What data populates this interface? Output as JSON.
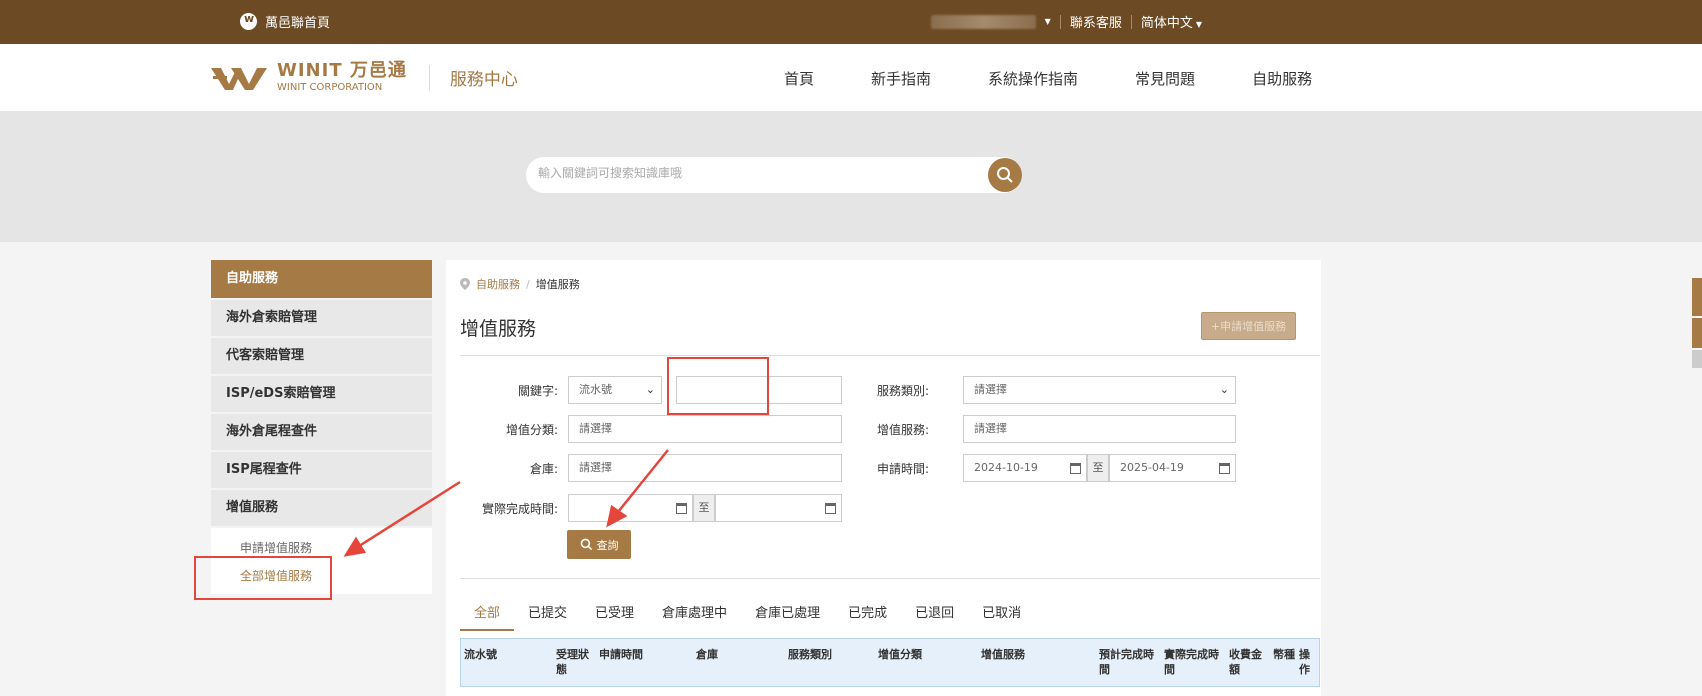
{
  "topbar": {
    "home_label": "萬邑聯首頁",
    "customer_service": "聯系客服",
    "language": "简体中文"
  },
  "header": {
    "brand_mark": "WINIT",
    "brand_cn": "万邑通",
    "brand_en": "WINIT CORPORATION",
    "center_title": "服務中心",
    "nav": [
      "首頁",
      "新手指南",
      "系統操作指南",
      "常見問題",
      "自助服務"
    ]
  },
  "search": {
    "placeholder": "輸入關鍵詞可搜索知識庫哦"
  },
  "sidebar": {
    "header": "自助服務",
    "items": [
      "海外倉索賠管理",
      "代客索賠管理",
      "ISP/eDS索賠管理",
      "海外倉尾程查件",
      "ISP尾程查件",
      "增值服務"
    ],
    "sub_items": [
      "申請增值服務",
      "全部增值服務"
    ]
  },
  "main": {
    "breadcrumb": [
      "自助服務",
      "增值服務"
    ],
    "title": "增值服務",
    "apply_button": "+申請增值服務",
    "form": {
      "keyword_label": "關鍵字:",
      "keyword_type": "流水號",
      "keyword_value": "",
      "service_type_label": "服務類別:",
      "service_type_value": "請選擇",
      "category_label": "增值分類:",
      "category_value": "請選擇",
      "vas_label": "增值服務:",
      "vas_value": "請選擇",
      "warehouse_label": "倉庫:",
      "warehouse_value": "請選擇",
      "apply_time_label": "申請時間:",
      "apply_from": "2024-10-19",
      "apply_to": "2025-04-19",
      "to_sep": "至",
      "actual_time_label": "實際完成時間:",
      "actual_from": "",
      "actual_to": "",
      "query_button": "查詢"
    },
    "tabs": [
      "全部",
      "已提交",
      "已受理",
      "倉庫處理中",
      "倉庫已處理",
      "已完成",
      "已退回",
      "已取消"
    ],
    "columns": [
      "流水號",
      "受理狀態",
      "申請時間",
      "倉庫",
      "服務類別",
      "增值分類",
      "增值服務",
      "預計完成時間",
      "實際完成時間",
      "收費金額",
      "幣種",
      "操作"
    ]
  },
  "colors": {
    "brand_brown": "#6b4a24",
    "accent": "#a57a45",
    "annotation_red": "#e5463b"
  }
}
